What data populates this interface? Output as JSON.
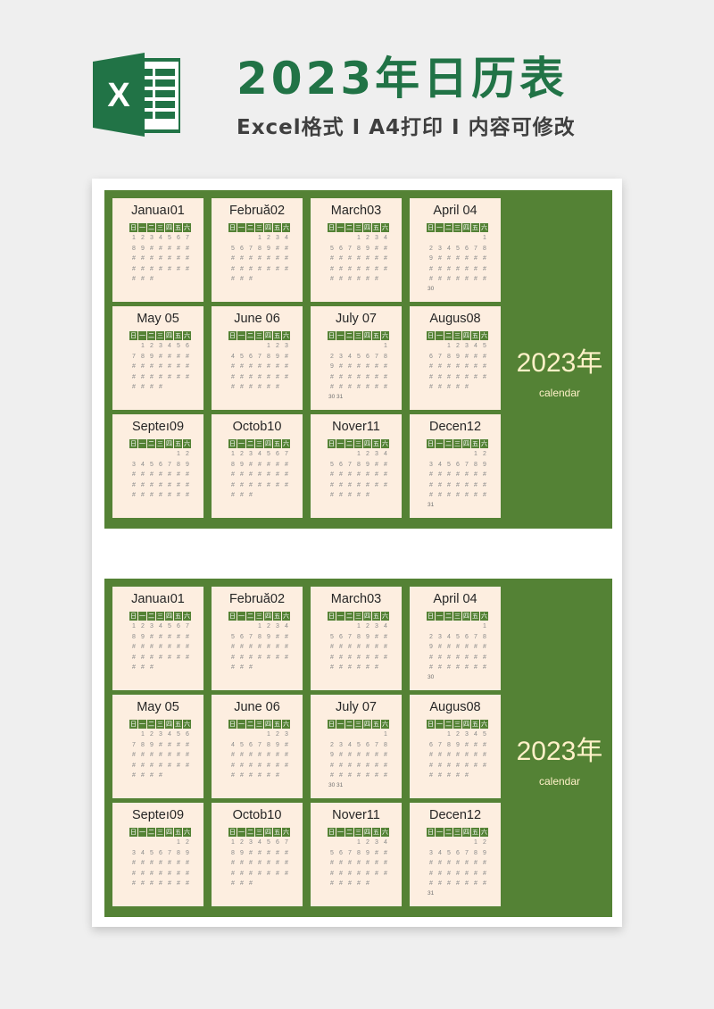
{
  "header": {
    "logo_icon": "excel-logo-icon",
    "logo_letter": "X",
    "title": "2023年日历表",
    "subtitle": "Excel格式 I A4打印 I 内容可修改"
  },
  "colors": {
    "brand_green": "#217346",
    "block_green": "#548235",
    "card_bg": "#fdeee0",
    "year_text": "#fff1c8"
  },
  "calendar": {
    "year_label": "2023年",
    "caption": "calendar",
    "weekdays": [
      "日",
      "一",
      "二",
      "三",
      "四",
      "五",
      "六"
    ],
    "months": [
      {
        "label": "Januaı 01",
        "name": "Januaı",
        "num": "01",
        "rows": [
          [
            "1",
            "2",
            "3",
            "4",
            "5",
            "6",
            "7"
          ],
          [
            "8",
            "9",
            "#",
            "#",
            "#",
            "#",
            "#"
          ],
          [
            "#",
            "#",
            "#",
            "#",
            "#",
            "#",
            "#"
          ],
          [
            "#",
            "#",
            "#",
            "#",
            "#",
            "#",
            "#"
          ],
          [
            "#",
            "#",
            "#",
            "",
            "",
            "",
            ""
          ]
        ],
        "extra": ""
      },
      {
        "name": "Februă",
        "num": "02",
        "rows": [
          [
            "",
            "",
            "",
            "1",
            "2",
            "3",
            "4"
          ],
          [
            "5",
            "6",
            "7",
            "8",
            "9",
            "#",
            "#"
          ],
          [
            "#",
            "#",
            "#",
            "#",
            "#",
            "#",
            "#"
          ],
          [
            "#",
            "#",
            "#",
            "#",
            "#",
            "#",
            "#"
          ],
          [
            "#",
            "#",
            "#",
            "",
            "",
            "",
            ""
          ]
        ],
        "extra": ""
      },
      {
        "name": "March",
        "num": "03",
        "rows": [
          [
            "",
            "",
            "",
            "1",
            "2",
            "3",
            "4"
          ],
          [
            "5",
            "6",
            "7",
            "8",
            "9",
            "#",
            "#"
          ],
          [
            "#",
            "#",
            "#",
            "#",
            "#",
            "#",
            "#"
          ],
          [
            "#",
            "#",
            "#",
            "#",
            "#",
            "#",
            "#"
          ],
          [
            "#",
            "#",
            "#",
            "#",
            "#",
            "#",
            ""
          ]
        ],
        "extra": ""
      },
      {
        "name": "April ",
        "num": "04",
        "rows": [
          [
            "",
            "",
            "",
            "",
            "",
            "",
            "1"
          ],
          [
            "2",
            "3",
            "4",
            "5",
            "6",
            "7",
            "8"
          ],
          [
            "9",
            "#",
            "#",
            "#",
            "#",
            "#",
            "#"
          ],
          [
            "#",
            "#",
            "#",
            "#",
            "#",
            "#",
            "#"
          ],
          [
            "#",
            "#",
            "#",
            "#",
            "#",
            "#",
            "#"
          ]
        ],
        "extra": "30"
      },
      {
        "name": "May ",
        "num": "05",
        "rows": [
          [
            "",
            "1",
            "2",
            "3",
            "4",
            "5",
            "6"
          ],
          [
            "7",
            "8",
            "9",
            "#",
            "#",
            "#",
            "#"
          ],
          [
            "#",
            "#",
            "#",
            "#",
            "#",
            "#",
            "#"
          ],
          [
            "#",
            "#",
            "#",
            "#",
            "#",
            "#",
            "#"
          ],
          [
            "#",
            "#",
            "#",
            "#",
            "",
            "",
            ""
          ]
        ],
        "extra": ""
      },
      {
        "name": "June ",
        "num": "06",
        "rows": [
          [
            "",
            "",
            "",
            "",
            "1",
            "2",
            "3"
          ],
          [
            "4",
            "5",
            "6",
            "7",
            "8",
            "9",
            "#"
          ],
          [
            "#",
            "#",
            "#",
            "#",
            "#",
            "#",
            "#"
          ],
          [
            "#",
            "#",
            "#",
            "#",
            "#",
            "#",
            "#"
          ],
          [
            "#",
            "#",
            "#",
            "#",
            "#",
            "#",
            ""
          ]
        ],
        "extra": ""
      },
      {
        "name": "July ",
        "num": "07",
        "rows": [
          [
            "",
            "",
            "",
            "",
            "",
            "",
            "1"
          ],
          [
            "2",
            "3",
            "4",
            "5",
            "6",
            "7",
            "8"
          ],
          [
            "9",
            "#",
            "#",
            "#",
            "#",
            "#",
            "#"
          ],
          [
            "#",
            "#",
            "#",
            "#",
            "#",
            "#",
            "#"
          ],
          [
            "#",
            "#",
            "#",
            "#",
            "#",
            "#",
            "#"
          ]
        ],
        "extra": "30 31"
      },
      {
        "name": "Augus",
        "num": "08",
        "rows": [
          [
            "",
            "",
            "1",
            "2",
            "3",
            "4",
            "5"
          ],
          [
            "6",
            "7",
            "8",
            "9",
            "#",
            "#",
            "#"
          ],
          [
            "#",
            "#",
            "#",
            "#",
            "#",
            "#",
            "#"
          ],
          [
            "#",
            "#",
            "#",
            "#",
            "#",
            "#",
            "#"
          ],
          [
            "#",
            "#",
            "#",
            "#",
            "#",
            "",
            ""
          ]
        ],
        "extra": ""
      },
      {
        "name": "Septeı",
        "num": "09",
        "rows": [
          [
            "",
            "",
            "",
            "",
            "",
            "1",
            "2"
          ],
          [
            "3",
            "4",
            "5",
            "6",
            "7",
            "8",
            "9"
          ],
          [
            "#",
            "#",
            "#",
            "#",
            "#",
            "#",
            "#"
          ],
          [
            "#",
            "#",
            "#",
            "#",
            "#",
            "#",
            "#"
          ],
          [
            "#",
            "#",
            "#",
            "#",
            "#",
            "#",
            "#"
          ]
        ],
        "extra": ""
      },
      {
        "name": "Octob",
        "num": "10",
        "rows": [
          [
            "1",
            "2",
            "3",
            "4",
            "5",
            "6",
            "7"
          ],
          [
            "8",
            "9",
            "#",
            "#",
            "#",
            "#",
            "#"
          ],
          [
            "#",
            "#",
            "#",
            "#",
            "#",
            "#",
            "#"
          ],
          [
            "#",
            "#",
            "#",
            "#",
            "#",
            "#",
            "#"
          ],
          [
            "#",
            "#",
            "#",
            "",
            "",
            "",
            ""
          ]
        ],
        "extra": ""
      },
      {
        "name": "Nover",
        "num": "11",
        "rows": [
          [
            "",
            "",
            "",
            "1",
            "2",
            "3",
            "4"
          ],
          [
            "5",
            "6",
            "7",
            "8",
            "9",
            "#",
            "#"
          ],
          [
            "#",
            "#",
            "#",
            "#",
            "#",
            "#",
            "#"
          ],
          [
            "#",
            "#",
            "#",
            "#",
            "#",
            "#",
            "#"
          ],
          [
            "#",
            "#",
            "#",
            "#",
            "#",
            "",
            ""
          ]
        ],
        "extra": ""
      },
      {
        "name": "Decen",
        "num": "12",
        "rows": [
          [
            "",
            "",
            "",
            "",
            "",
            "1",
            "2"
          ],
          [
            "3",
            "4",
            "5",
            "6",
            "7",
            "8",
            "9"
          ],
          [
            "#",
            "#",
            "#",
            "#",
            "#",
            "#",
            "#"
          ],
          [
            "#",
            "#",
            "#",
            "#",
            "#",
            "#",
            "#"
          ],
          [
            "#",
            "#",
            "#",
            "#",
            "#",
            "#",
            "#"
          ]
        ],
        "extra": "31"
      }
    ]
  }
}
